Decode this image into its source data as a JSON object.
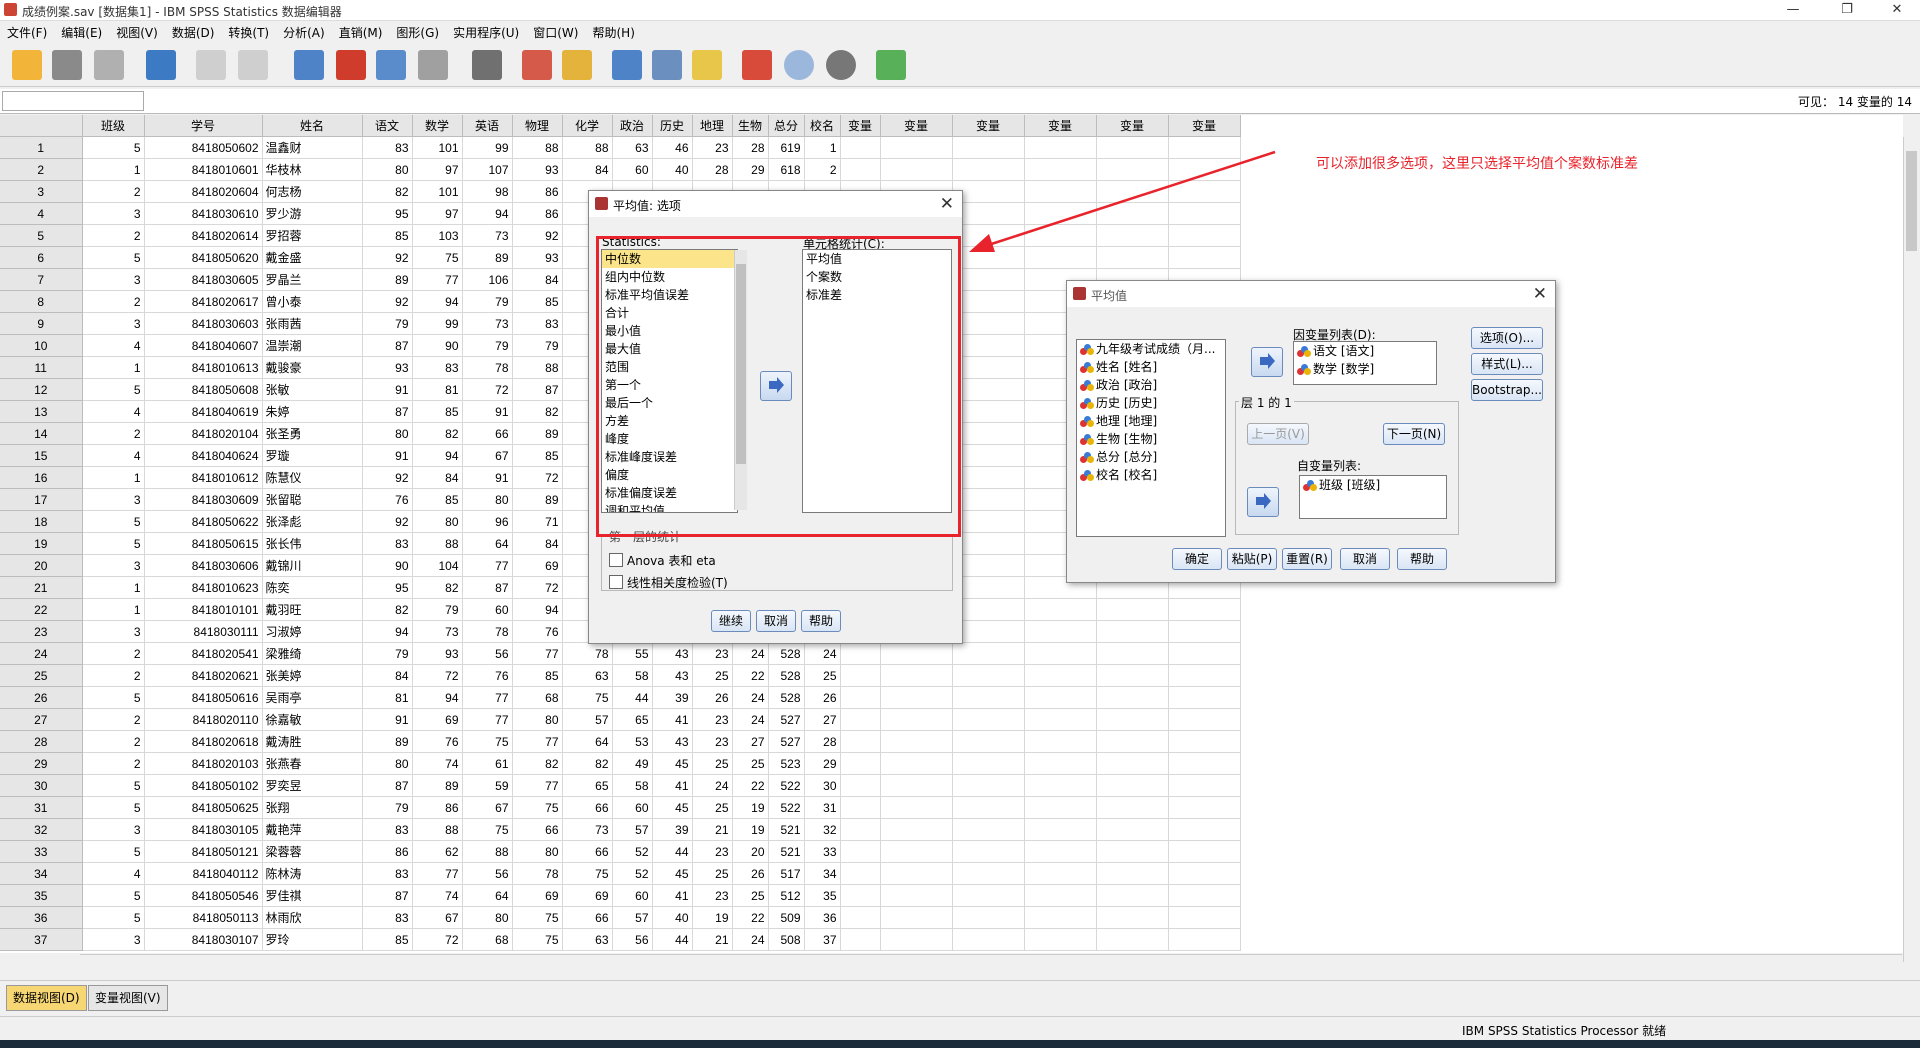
{
  "window": {
    "title": "成绩例案.sav [数据集1] - IBM SPSS Statistics 数据编辑器",
    "controls": [
      "—",
      "❐",
      "✕"
    ]
  },
  "menu": [
    "文件(F)",
    "编辑(E)",
    "视图(V)",
    "数据(D)",
    "转换(T)",
    "分析(A)",
    "直销(M)",
    "图形(G)",
    "实用程序(U)",
    "窗口(W)",
    "帮助(H)"
  ],
  "toolbar_icons": [
    "open-icon",
    "save-icon",
    "print-icon",
    "dialog-recall-icon",
    "undo-icon",
    "redo-icon",
    "goto-case-icon",
    "goto-variable-icon",
    "variables-icon",
    "run-descriptive-icon",
    "find-icon",
    "insert-cases-icon",
    "insert-variable-icon",
    "split-file-icon",
    "weight-cases-icon",
    "select-cases-icon",
    "value-labels-icon",
    "use-sets-icon",
    "show-all-variables-icon",
    "spell-check-icon"
  ],
  "cellbar": {
    "visible": "可见： 14 变量的 14"
  },
  "grid": {
    "columns": [
      "班级",
      "学号",
      "姓名",
      "语文",
      "数学",
      "英语",
      "物理",
      "化学",
      "政治",
      "历史",
      "地理",
      "生物",
      "总分",
      "校名",
      "变量",
      "变量",
      "变量",
      "变量",
      "变量",
      "变量"
    ],
    "rows": [
      [
        5,
        "8418050602",
        "温鑫财",
        83,
        101,
        99,
        88,
        88,
        63,
        46,
        23,
        28,
        619,
        1
      ],
      [
        1,
        "8418010601",
        "华枝林",
        80,
        97,
        107,
        93,
        84,
        60,
        40,
        28,
        29,
        618,
        2
      ],
      [
        2,
        "8418020604",
        "何志杨",
        82,
        101,
        98,
        86,
        "",
        "",
        "",
        "",
        "",
        "",
        ""
      ],
      [
        3,
        "8418030610",
        "罗少游",
        95,
        97,
        94,
        86,
        "",
        "",
        "",
        "",
        "",
        "",
        ""
      ],
      [
        2,
        "8418020614",
        "罗招蓉",
        85,
        103,
        73,
        92,
        "",
        "",
        "",
        "",
        "",
        "",
        ""
      ],
      [
        5,
        "8418050620",
        "戴金盛",
        92,
        75,
        89,
        93,
        "",
        "",
        "",
        "",
        "",
        "",
        ""
      ],
      [
        3,
        "8418030605",
        "罗晶兰",
        89,
        77,
        106,
        84,
        "",
        "",
        "",
        "",
        "",
        "",
        ""
      ],
      [
        2,
        "8418020617",
        "曾小泰",
        92,
        94,
        79,
        85,
        "",
        "",
        "",
        "",
        "",
        "",
        ""
      ],
      [
        3,
        "8418030603",
        "张雨茜",
        79,
        99,
        73,
        83,
        "",
        "",
        "",
        "",
        "",
        "",
        ""
      ],
      [
        4,
        "8418040607",
        "温崇潮",
        87,
        90,
        79,
        79,
        "",
        "",
        "",
        "",
        "",
        "",
        ""
      ],
      [
        1,
        "8418010613",
        "戴骏豪",
        93,
        83,
        78,
        88,
        "",
        "",
        "",
        "",
        "",
        "",
        ""
      ],
      [
        5,
        "8418050608",
        "张敏",
        91,
        81,
        72,
        87,
        "",
        "",
        "",
        "",
        "",
        "",
        ""
      ],
      [
        4,
        "8418040619",
        "朱婷",
        87,
        85,
        91,
        82,
        "",
        "",
        "",
        "",
        "",
        "",
        ""
      ],
      [
        2,
        "8418020104",
        "张圣勇",
        80,
        82,
        66,
        89,
        "",
        "",
        "",
        "",
        "",
        "",
        ""
      ],
      [
        4,
        "8418040624",
        "罗璇",
        91,
        94,
        67,
        85,
        "",
        "",
        "",
        "",
        "",
        "",
        ""
      ],
      [
        1,
        "8418010612",
        "陈慧仪",
        92,
        84,
        91,
        72,
        "",
        "",
        "",
        "",
        "",
        "",
        ""
      ],
      [
        3,
        "8418030609",
        "张留聪",
        76,
        85,
        80,
        89,
        "",
        "",
        "",
        "",
        "",
        "",
        ""
      ],
      [
        5,
        "8418050622",
        "张泽彪",
        92,
        80,
        96,
        71,
        "",
        "",
        "",
        "",
        "",
        "",
        ""
      ],
      [
        5,
        "8418050615",
        "张长伟",
        83,
        88,
        64,
        84,
        "",
        "",
        "",
        "",
        "",
        "",
        ""
      ],
      [
        3,
        "8418030606",
        "戴锦川",
        90,
        104,
        77,
        69,
        "",
        "",
        "",
        "",
        "",
        "",
        ""
      ],
      [
        1,
        "8418010623",
        "陈奕",
        95,
        82,
        87,
        72,
        "",
        "",
        "",
        "",
        "",
        "",
        ""
      ],
      [
        1,
        "8418010101",
        "戴羽旺",
        82,
        79,
        60,
        94,
        "",
        "",
        "",
        "",
        "",
        "",
        ""
      ],
      [
        3,
        "8418030111",
        "习淑婷",
        94,
        73,
        78,
        76,
        "",
        "",
        "",
        "",
        "",
        "",
        ""
      ],
      [
        2,
        "8418020541",
        "梁雅绮",
        79,
        93,
        56,
        77,
        78,
        55,
        43,
        23,
        24,
        528,
        24
      ],
      [
        2,
        "8418020621",
        "张美婷",
        84,
        72,
        76,
        85,
        63,
        58,
        43,
        25,
        22,
        528,
        25
      ],
      [
        5,
        "8418050616",
        "吴雨亭",
        81,
        94,
        77,
        68,
        75,
        44,
        39,
        26,
        24,
        528,
        26
      ],
      [
        2,
        "8418020110",
        "徐嘉敏",
        91,
        69,
        77,
        80,
        57,
        65,
        41,
        23,
        24,
        527,
        27
      ],
      [
        2,
        "8418020618",
        "戴涛胜",
        89,
        76,
        75,
        77,
        64,
        53,
        43,
        23,
        27,
        527,
        28
      ],
      [
        2,
        "8418020103",
        "张燕春",
        80,
        74,
        61,
        82,
        82,
        49,
        45,
        25,
        25,
        523,
        29
      ],
      [
        5,
        "8418050102",
        "罗奕昱",
        87,
        89,
        59,
        77,
        65,
        58,
        41,
        24,
        22,
        522,
        30
      ],
      [
        5,
        "8418050625",
        "张翔",
        79,
        86,
        67,
        75,
        66,
        60,
        45,
        25,
        19,
        522,
        31
      ],
      [
        3,
        "8418030105",
        "戴艳萍",
        83,
        88,
        75,
        66,
        73,
        57,
        39,
        21,
        19,
        521,
        32
      ],
      [
        5,
        "8418050121",
        "梁蓉蓉",
        86,
        62,
        88,
        80,
        66,
        52,
        44,
        23,
        20,
        521,
        33
      ],
      [
        4,
        "8418040112",
        "陈林涛",
        83,
        77,
        56,
        78,
        75,
        52,
        45,
        25,
        26,
        517,
        34
      ],
      [
        5,
        "8418050546",
        "罗佳祺",
        87,
        74,
        64,
        69,
        69,
        60,
        41,
        23,
        25,
        512,
        35
      ],
      [
        5,
        "8418050113",
        "林雨欣",
        83,
        67,
        80,
        75,
        66,
        57,
        40,
        19,
        22,
        509,
        36
      ],
      [
        3,
        "8418030107",
        "罗玲",
        85,
        72,
        68,
        75,
        63,
        56,
        44,
        21,
        24,
        508,
        37
      ]
    ]
  },
  "tabs": {
    "data_view": "数据视图(D)",
    "variable_view": "变量视图(V)"
  },
  "status": "IBM SPSS Statistics Processor 就绪",
  "options_dialog": {
    "title": "平均值: 选项",
    "statistics_label": "Statistics:",
    "statistics": [
      "中位数",
      "组内中位数",
      "标准平均值误差",
      "合计",
      "最小值",
      "最大值",
      "范围",
      "第一个",
      "最后一个",
      "方差",
      "峰度",
      "标准峰度误差",
      "偏度",
      "标准偏度误差",
      "调和平均值"
    ],
    "selected_statistic": "中位数",
    "cell_stats_label": "单元格统计(C):",
    "cell_stats": [
      "平均值",
      "个案数",
      "标准差"
    ],
    "first_layer_label": "第一层的统计",
    "anova_label": "Anova 表和 eta",
    "linearity_label": "线性相关度检验(T)",
    "continue": "继续",
    "cancel": "取消",
    "help": "帮助"
  },
  "means_dialog": {
    "title": "平均值",
    "source_vars": [
      "九年级考试成绩（月...",
      "姓名 [姓名]",
      "政治 [政治]",
      "历史 [历史]",
      "地理 [地理]",
      "生物 [生物]",
      "总分 [总分]",
      "校名 [校名]"
    ],
    "dependent_label": "因变量列表(D):",
    "dependent_vars": [
      "语文 [语文]",
      "数学 [数学]"
    ],
    "layer_label": "层 1 的 1",
    "prev_button": "上一页(V)",
    "next_button": "下一页(N)",
    "independent_label": "自变量列表:",
    "independent_vars": [
      "班级 [班级]"
    ],
    "options_button": "选项(O)...",
    "style_button": "样式(L)...",
    "bootstrap_button": "Bootstrap...",
    "ok": "确定",
    "paste": "粘贴(P)",
    "reset": "重置(R)",
    "cancel": "取消",
    "help": "帮助"
  },
  "annotation": "可以添加很多选项，这里只选择平均值个案数标准差",
  "colors": {
    "highlight": "#e8232b",
    "selected_row": "#fbe48a"
  }
}
